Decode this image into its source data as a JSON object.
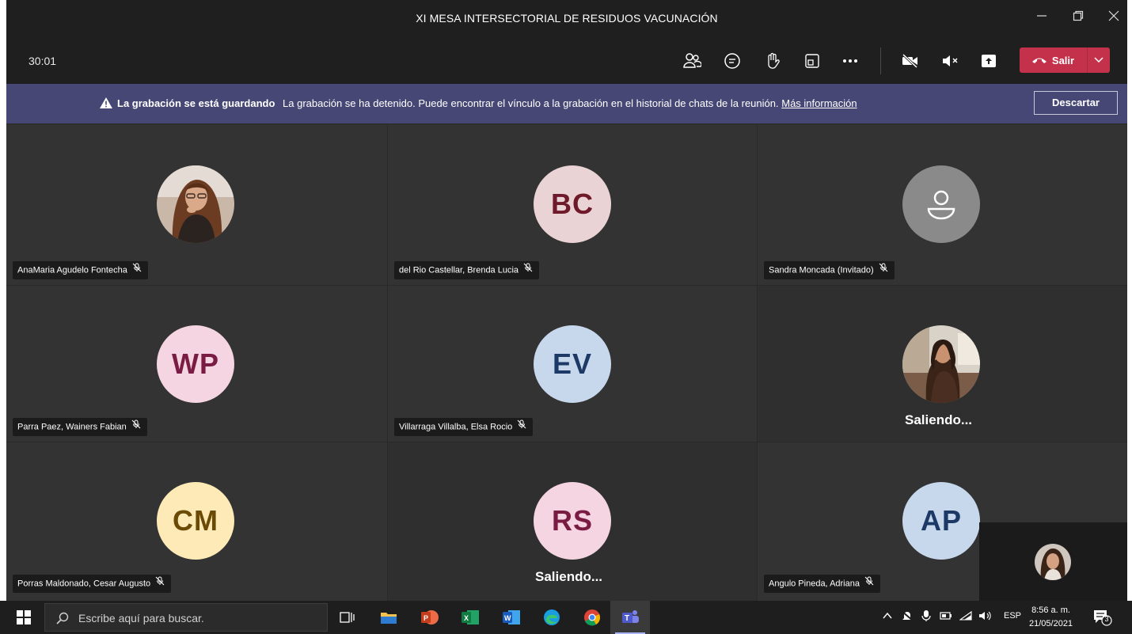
{
  "window": {
    "title": "XI MESA INTERSECTORIAL DE RESIDUOS VACUNACIÓN",
    "minimize_icon": "minimize-icon",
    "restore_icon": "restore-icon",
    "close_icon": "close-icon"
  },
  "controls": {
    "timer": "30:01",
    "leave_label": "Salir",
    "icons": [
      "participants-icon",
      "chat-icon",
      "raise-hand-icon",
      "rooms-icon",
      "more-options-icon",
      "camera-off-icon",
      "speaker-muted-icon",
      "share-screen-icon"
    ]
  },
  "banner": {
    "title": "La grabación se está guardando",
    "message": "La grabación se ha detenido. Puede encontrar el vínculo a la grabación en el historial de chats de la reunión.",
    "link": "Más información",
    "dismiss": "Descartar"
  },
  "participants": [
    {
      "name": "AnaMaria Agudelo Fontecha",
      "initials": "",
      "avatar": "photo",
      "muted": true
    },
    {
      "name": "del Rio Castellar, Brenda Lucia",
      "initials": "BC",
      "bg": "#ead3d4",
      "fg": "#6e1a2b",
      "muted": true
    },
    {
      "name": "Sandra Moncada (Invitado)",
      "initials": "",
      "avatar": "guest-person-icon",
      "bg": "#8a8a8a",
      "muted": true
    },
    {
      "name": "Parra Paez, Wainers Fabian",
      "initials": "WP",
      "bg": "#f4d5e1",
      "fg": "#7a1b43",
      "muted": true
    },
    {
      "name": "Villarraga Villalba, Elsa Rocio",
      "initials": "EV",
      "bg": "#c8d8ec",
      "fg": "#1d3a66",
      "muted": true
    },
    {
      "name": "",
      "initials": "",
      "avatar": "photo",
      "status": "Saliendo..."
    },
    {
      "name": "Porras Maldonado, Cesar Augusto",
      "initials": "CM",
      "bg": "#fdeab6",
      "fg": "#6b4a05",
      "muted": true
    },
    {
      "name": "",
      "initials": "RS",
      "bg": "#f4d5e1",
      "fg": "#7a1b43",
      "status": "Saliendo..."
    },
    {
      "name": "Angulo Pineda, Adriana",
      "initials": "AP",
      "bg": "#c8d8ec",
      "fg": "#1d3a66",
      "muted": true
    }
  ],
  "taskbar": {
    "search_placeholder": "Escribe aquí para buscar.",
    "language": "ESP",
    "time": "8:56 a. m.",
    "date": "21/05/2021",
    "notification_count": "3",
    "apps": [
      "task-view-icon",
      "file-explorer-icon",
      "powerpoint-icon",
      "excel-icon",
      "word-icon",
      "edge-icon",
      "chrome-icon",
      "teams-icon"
    ]
  }
}
